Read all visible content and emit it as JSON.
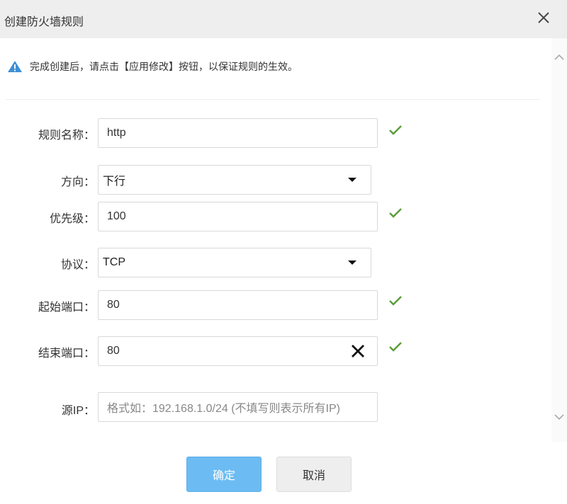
{
  "dialog": {
    "title": "创建防火墙规则",
    "notice": "完成创建后，请点击【应用修改】按钮，以保证规则的生效。"
  },
  "form": {
    "rule_name": {
      "label": "规则名称：",
      "value": "http",
      "valid": true
    },
    "direction": {
      "label": "方向：",
      "selected": "下行"
    },
    "priority": {
      "label": "优先级：",
      "value": "100",
      "valid": true
    },
    "protocol": {
      "label": "协议：",
      "selected": "TCP"
    },
    "start_port": {
      "label": "起始端口：",
      "value": "80",
      "valid": true
    },
    "end_port": {
      "label": "结束端口：",
      "value": "80",
      "valid": true
    },
    "source_ip": {
      "label": "源IP：",
      "placeholder": "格式如：192.168.1.0/24 (不填写则表示所有IP)"
    }
  },
  "buttons": {
    "confirm": "确定",
    "cancel": "取消"
  },
  "icons": {
    "close": "close-icon",
    "warning": "warning-icon",
    "valid": "checkmark-icon",
    "clear": "clear-icon",
    "dropdown": "caret-down-icon",
    "scroll_up": "chevron-up-icon",
    "scroll_down": "chevron-down-icon"
  },
  "colors": {
    "primary": "#6cbcf3",
    "success": "#5a9e3a",
    "warning": "#3d8fd6",
    "titlebar": "#eeeeee"
  }
}
